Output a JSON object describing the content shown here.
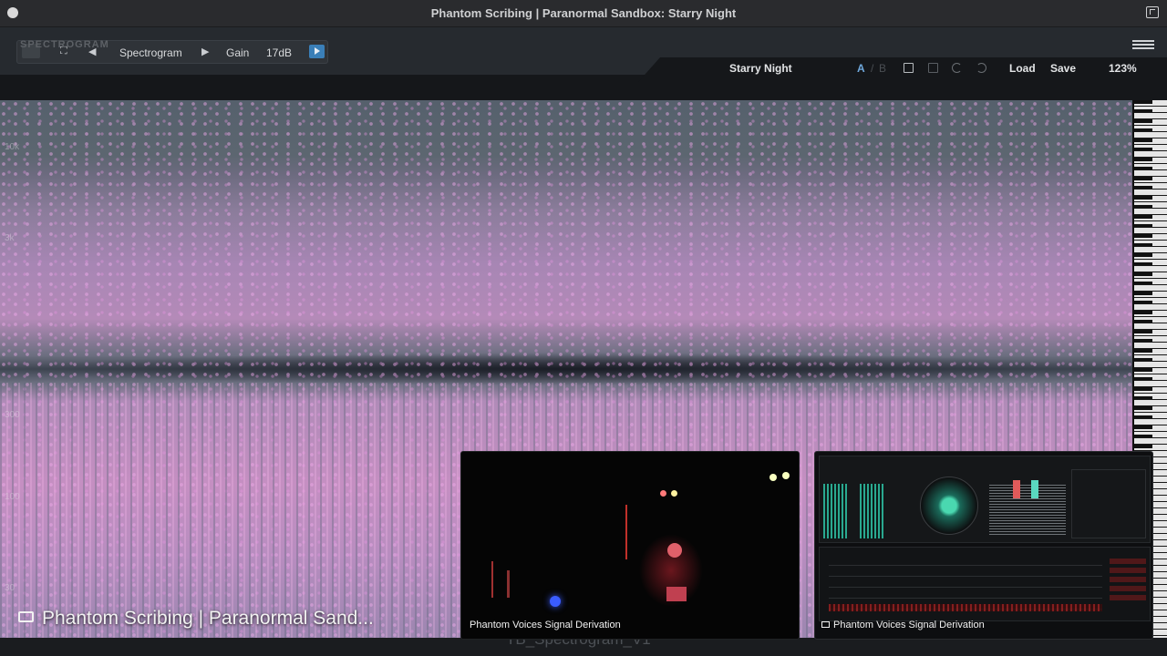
{
  "window": {
    "title": "Phantom Scribing | Paranormal Sandbox: Starry Night"
  },
  "toolbar": {
    "logo_text": "SPECTROGRAM",
    "view_mode": "Spectrogram",
    "gain_label": "Gain",
    "gain_value": "17dB"
  },
  "preset": {
    "name": "Starry Night",
    "ab_a": "A",
    "ab_sep": "/",
    "ab_b": "B",
    "load_label": "Load",
    "save_label": "Save",
    "zoom": "123%"
  },
  "spectrogram": {
    "freq_labels": [
      "10k",
      "3k",
      "300",
      "100",
      "30"
    ]
  },
  "overlays": {
    "main_title": "Phantom Scribing | Paranormal Sand...",
    "ghost_name": "TB_Spectrogram_V1",
    "camera_caption": "Phantom Voices Signal Derivation",
    "meter_caption": "Phantom Voices Signal Derivation"
  },
  "colors": {
    "accent": "#3a7fb8",
    "spectrum_pink": "#c58fc2",
    "spectrum_gray": "#5c6670"
  }
}
